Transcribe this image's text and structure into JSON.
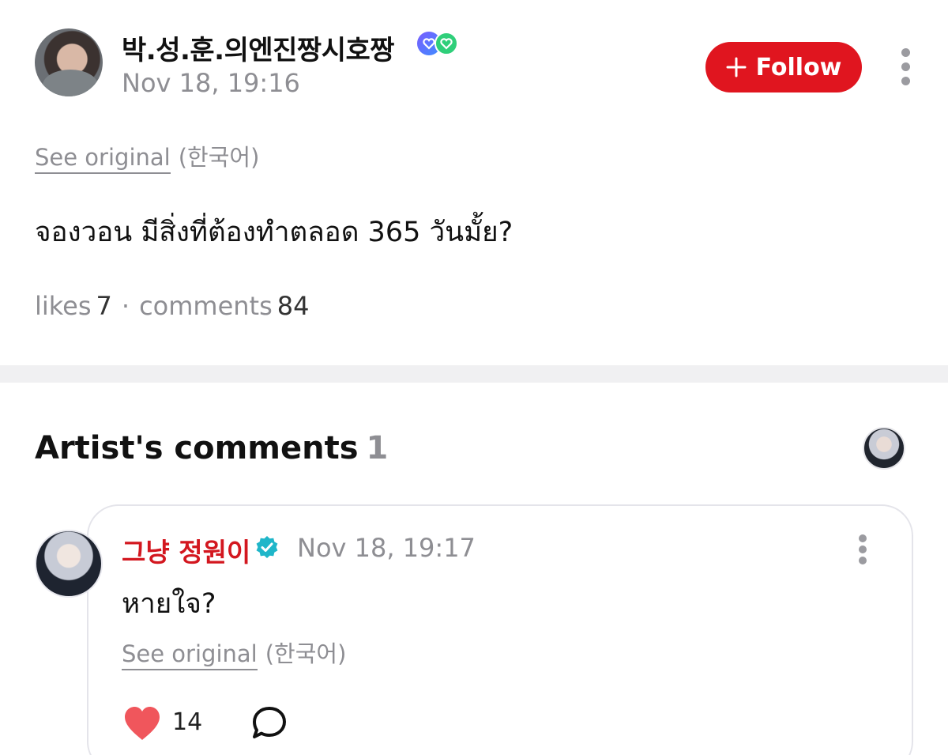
{
  "post": {
    "author": "박.성.훈.의엔진짱시호짱",
    "time": "Nov 18, 19:16",
    "follow_label": "Follow",
    "see_original": "See original",
    "original_language": "(한국어)",
    "body": "จองวอน มีสิ่งที่ต้องทำตลอด 365 วันมั้ย?",
    "likes_label": "likes",
    "likes": "7",
    "separator": "·",
    "comments_label": "comments",
    "comments": "84"
  },
  "artist_comments": {
    "title": "Artist's comments",
    "count": "1"
  },
  "comment": {
    "author": "그냥 정원이",
    "time": "Nov 18, 19:17",
    "body": "หายใจ?",
    "see_original": "See original",
    "original_language": "(한국어)",
    "likes": "14"
  },
  "colors": {
    "accent_red": "#e0151f",
    "artist_name_red": "#d3171f",
    "verified_teal": "#1fb6c9",
    "muted_text": "#8e8e93",
    "heart": "#f0565c"
  },
  "icons": [
    "plus-icon",
    "more-vertical-icon",
    "verified-badge-icon",
    "heart-icon",
    "reply-bubble-icon"
  ]
}
